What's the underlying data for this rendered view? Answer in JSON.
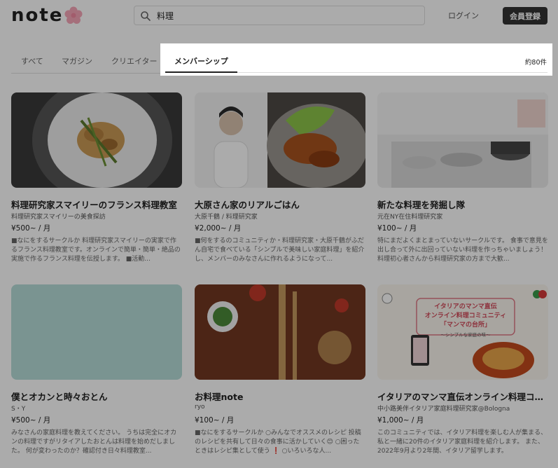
{
  "header": {
    "logo_text": "note",
    "search": {
      "value": "料理",
      "placeholder": ""
    },
    "login_label": "ログイン",
    "signup_label": "会員登録"
  },
  "tabs": {
    "items": [
      {
        "label": "すべて"
      },
      {
        "label": "マガジン"
      },
      {
        "label": "クリエイター"
      },
      {
        "label": "メンバーシップ",
        "active": true
      }
    ],
    "result_count": "約80件"
  },
  "cards": [
    {
      "title": "料理研究家スマイリーのフランス料理教室",
      "author": "料理研究家スマイリーの美食探訪",
      "price": "¥500~ / 月",
      "description": "■なにをするサークルか 料理研究家スマイリーの実家で作るフランス料理教室です。オンラインで簡単・簡単・絶品の実施で作るフランス料理を伝授します。 ■活動..."
    },
    {
      "title": "大原さん家のリアルごはん",
      "author": "大原千鶴 / 料理研究家",
      "price": "¥2,000~ / 月",
      "description": "■何をするのコミュニティか・料理研究家・大原千鶴がふだん自宅で食べている「シンプルで美味しい家庭料理」を紹介し、メンバーのみなさんに作れるようになって..."
    },
    {
      "title": "新たな料理を発掘し隊",
      "author": "元在NY在住料理研究家",
      "price": "¥100~ / 月",
      "description": "特にまだよくまとまっていないサークルです。 食事で意見を出し合って外に出回っていない料理を作っちゃいましょう！ 料理初心者さんから料理研究家の方まで大歓..."
    },
    {
      "title": "僕とオカンと時々おとん",
      "author": "S・Y",
      "price": "¥500~ / 月",
      "description": "みなさんの家庭料理を教えてください。 うちは完全にオカンの料理ですがリタイアしたおとんは料理を始めだしました。 何が変わったのか？確認付き日々料理教室..."
    },
    {
      "title": "お料理note",
      "author": "ryo",
      "price": "¥100~ / 月",
      "description": "■なにをするサークルか ○みんなでオススメのレシピ 投稿のレシピを共有して日々の食事に活かしていく😊 ○困ったときはレシピ集として使う ❗ ○いろいろな人..."
    },
    {
      "title": "イタリアのマンマ直伝オンライン料理コミュニティ「マンマの台所」",
      "author": "中小路美伴イタリア家庭料理研究家@Bologna",
      "price": "¥1,000~ / 月",
      "description": "このコミュニティでは、イタリア料理を楽しむ人が集まる、私と一緒に20件のイタリア家庭料理を紹介します。 また、2022年9月より2年間、イタリア留学します。"
    }
  ],
  "banner": {
    "line1": "イタリアのマンマ直伝",
    "line2": "オンライン料理コミュニティ",
    "line3": "「マンマの台所」",
    "line4": "〜シンプルな家庭の味〜"
  }
}
